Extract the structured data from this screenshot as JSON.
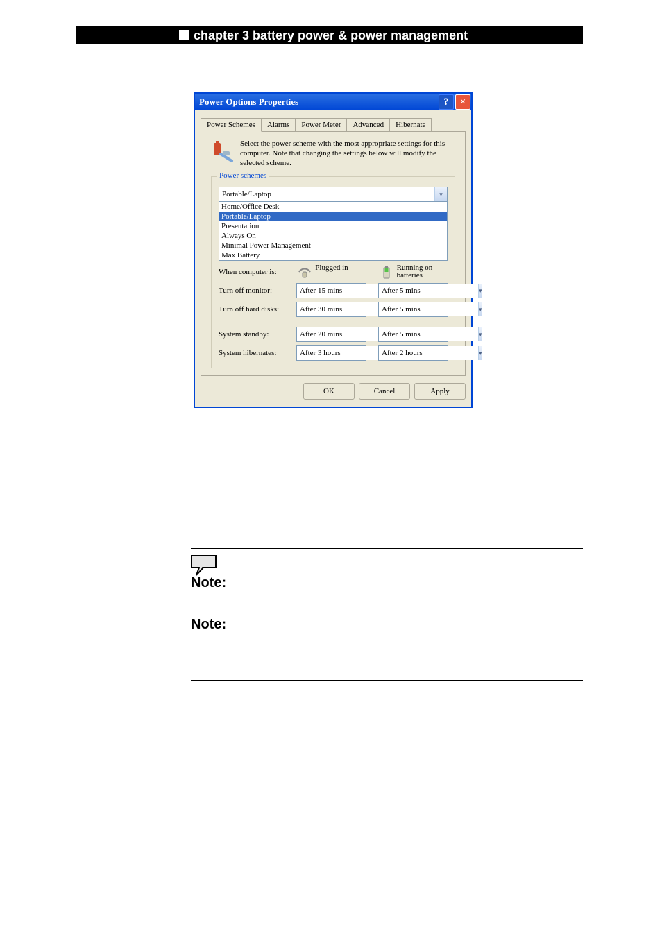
{
  "page_header": "chapter 3 battery power & power management",
  "dialog": {
    "title": "Power Options Properties",
    "help_icon": "?",
    "close_icon": "×",
    "tabs": [
      "Power Schemes",
      "Alarms",
      "Power Meter",
      "Advanced",
      "Hibernate"
    ],
    "intro": "Select the power scheme with the most appropriate settings for this computer. Note that changing the settings below will modify the selected scheme.",
    "group1_label": "Power schemes",
    "combo_value": "Portable/Laptop",
    "list": [
      "Home/Office Desk",
      "Portable/Laptop",
      "Presentation",
      "Always On",
      "Minimal Power Management",
      "Max Battery"
    ],
    "when_label": "When computer is:",
    "col_plugged": "Plugged in",
    "col_battery_top": "Running on",
    "col_battery_bot": "batteries",
    "rows": [
      {
        "label": "Turn off monitor:",
        "plugged": "After 15 mins",
        "battery": "After 5 mins"
      },
      {
        "label": "Turn off hard disks:",
        "plugged": "After 30 mins",
        "battery": "After 5 mins"
      }
    ],
    "rows2": [
      {
        "label": "System standby:",
        "plugged": "After 20 mins",
        "battery": "After 5 mins"
      },
      {
        "label": "System hibernates:",
        "plugged": "After 3 hours",
        "battery": "After 2 hours"
      }
    ],
    "buttons": {
      "ok": "OK",
      "cancel": "Cancel",
      "apply": "Apply"
    }
  },
  "note_label": "Note:"
}
